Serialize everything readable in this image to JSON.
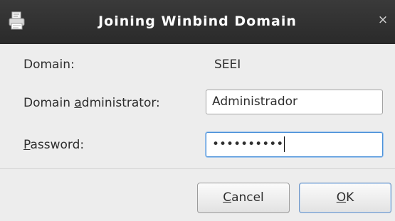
{
  "window": {
    "title": "Joining Winbind Domain",
    "close_glyph": "×",
    "icon": "printer-icon"
  },
  "form": {
    "domain": {
      "label": "Domain:",
      "value": "SEEI"
    },
    "admin": {
      "label_pre": "Domain ",
      "label_mnemonic": "a",
      "label_post": "dministrator:",
      "value": "Administrador"
    },
    "password": {
      "label_mnemonic": "P",
      "label_post": "assword:",
      "masked_value": "••••••••••"
    }
  },
  "buttons": {
    "cancel": {
      "mnemonic": "C",
      "rest": "ancel"
    },
    "ok": {
      "mnemonic": "O",
      "rest": "K"
    }
  },
  "colors": {
    "titlebar": "#2a2a2a",
    "dialog_bg": "#ededed",
    "focus": "#4a90d9"
  }
}
